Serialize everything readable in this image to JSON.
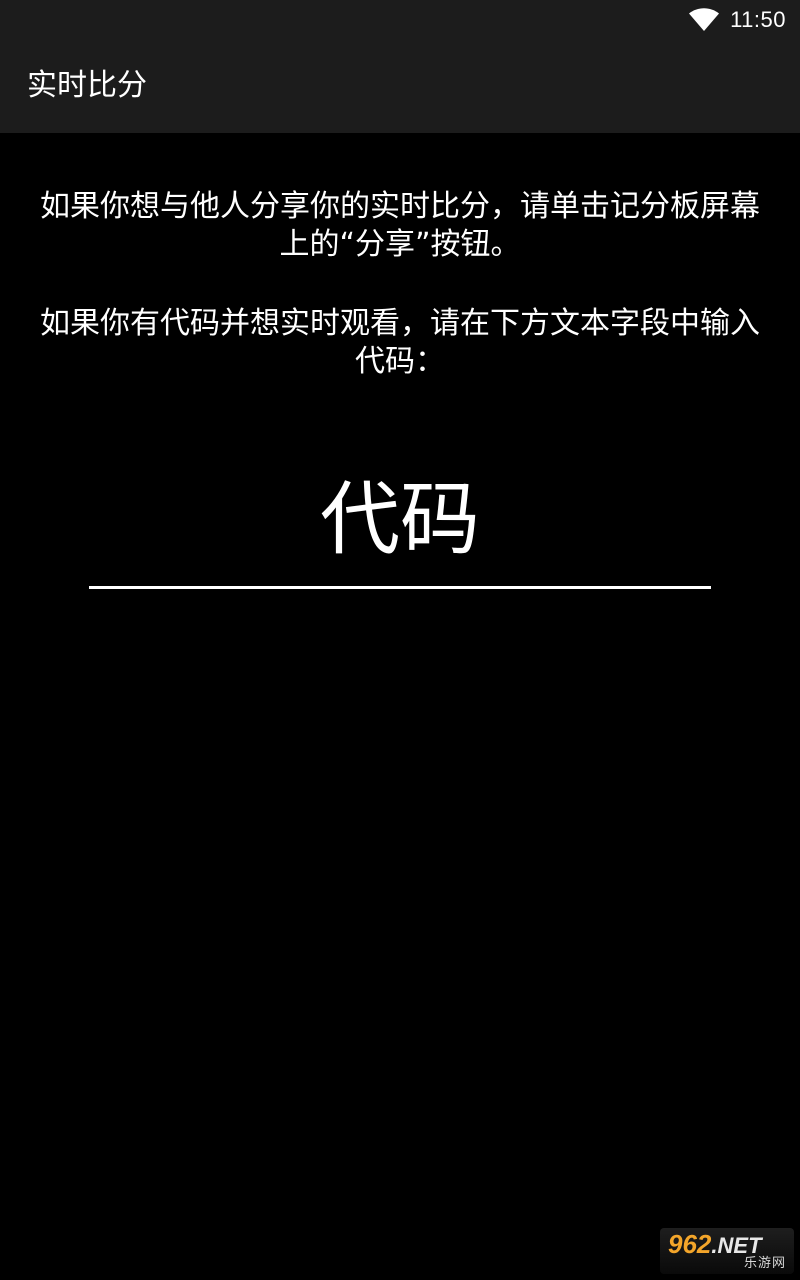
{
  "status_bar": {
    "time": "11:50",
    "icons": [
      "wifi-icon"
    ]
  },
  "app_bar": {
    "title": "实时比分"
  },
  "main": {
    "instruction_share": "如果你想与他人分享你的实时比分，请单击记分板屏幕上的“分享”按钮。",
    "instruction_code": "如果你有代码并想实时观看，请在下方文本字段中输入代码：",
    "code_input": {
      "placeholder": "代码",
      "value": ""
    }
  },
  "watermark": {
    "number": "962",
    "suffix": ".NET",
    "subtitle": "乐游网"
  },
  "colors": {
    "background": "#000000",
    "bar_background": "#1c1c1c",
    "text": "#ffffff",
    "watermark_accent": "#f3a52a"
  }
}
